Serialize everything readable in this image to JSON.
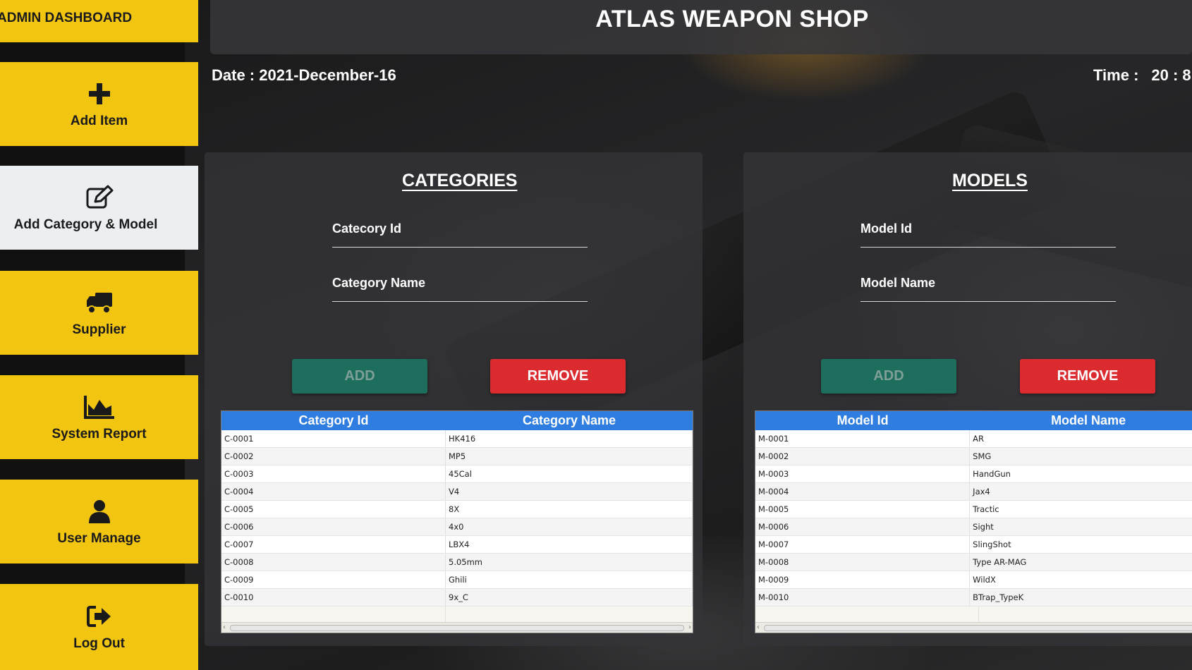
{
  "sidebar": {
    "title": "ADMIN DASHBOARD",
    "items": [
      {
        "label": "Add Item",
        "icon": "plus-icon"
      },
      {
        "label": "Add Category & Model",
        "icon": "edit-icon"
      },
      {
        "label": "Supplier",
        "icon": "truck-icon"
      },
      {
        "label": "System Report",
        "icon": "area-chart-icon"
      },
      {
        "label": "User Manage",
        "icon": "user-icon"
      },
      {
        "label": "Log Out",
        "icon": "logout-icon"
      }
    ],
    "active_index": 1
  },
  "header": {
    "title": "ATLAS WEAPON SHOP",
    "date_label": "Date : 2021-December-16",
    "time_label": "Time :",
    "time_value": "20 : 8"
  },
  "categories": {
    "title": "CATEGORIES",
    "id_label": "Catecory Id",
    "name_label": "Category Name",
    "add_label": "ADD",
    "remove_label": "REMOVE",
    "columns": [
      "Category Id",
      "Category Name"
    ],
    "rows": [
      [
        "C-0001",
        "HK416"
      ],
      [
        "C-0002",
        "MP5"
      ],
      [
        "C-0003",
        "45Cal"
      ],
      [
        "C-0004",
        "V4"
      ],
      [
        "C-0005",
        "8X"
      ],
      [
        "C-0006",
        "4x0"
      ],
      [
        "C-0007",
        "LBX4"
      ],
      [
        "C-0008",
        "5.05mm"
      ],
      [
        "C-0009",
        "Ghili"
      ],
      [
        "C-0010",
        "9x_C"
      ]
    ]
  },
  "models": {
    "title": "MODELS",
    "id_label": "Model Id",
    "name_label": "Model Name",
    "add_label": "ADD",
    "remove_label": "REMOVE",
    "columns": [
      "Model Id",
      "Model Name"
    ],
    "rows": [
      [
        "M-0001",
        "AR"
      ],
      [
        "M-0002",
        "SMG"
      ],
      [
        "M-0003",
        "HandGun"
      ],
      [
        "M-0004",
        "Jax4"
      ],
      [
        "M-0005",
        "Tractic"
      ],
      [
        "M-0006",
        "Sight"
      ],
      [
        "M-0007",
        "SlingShot"
      ],
      [
        "M-0008",
        "Type AR-MAG"
      ],
      [
        "M-0009",
        "WildX"
      ],
      [
        "M-0010",
        "BTrap_TypeK"
      ]
    ]
  },
  "colors": {
    "sidebar_yellow": "#f2c511",
    "active_item": "#eceff1",
    "add_button": "#1e6e5e",
    "remove_button": "#db2b2f",
    "table_header": "#2f7de1"
  }
}
